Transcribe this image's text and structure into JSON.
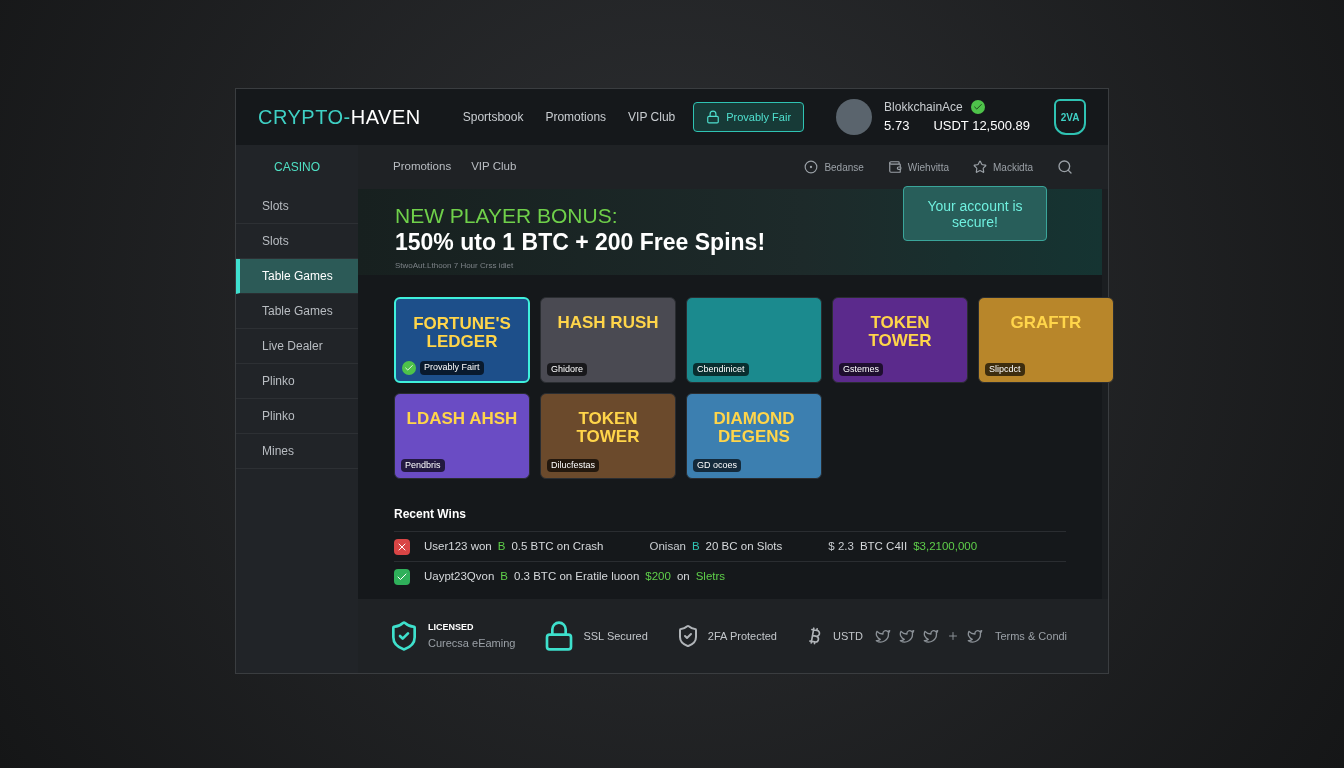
{
  "header": {
    "logo": {
      "part1": "CRYPTO-",
      "part2": "HAVEN"
    },
    "nav": [
      "Sportsbook",
      "Promotions",
      "VIP Club"
    ],
    "fair_button": "Provably Fair",
    "user": {
      "name": "BlokkchainAce",
      "verified": true,
      "stat": "5.73",
      "balance": "USDT 12,500.89"
    },
    "badge": "2VA"
  },
  "subnav": {
    "links": [
      "Promotions",
      "VIP Club"
    ],
    "tools": [
      {
        "kind": "coin",
        "label": "Bedanse"
      },
      {
        "kind": "wallet",
        "label": "Wiehvitta"
      },
      {
        "kind": "star",
        "label": "Mackidta"
      }
    ]
  },
  "sidebar": {
    "heading": "CASINO",
    "items": [
      {
        "label": "Slots",
        "selected": false
      },
      {
        "label": "Slots",
        "selected": false
      },
      {
        "label": "Table Games",
        "selected": true
      },
      {
        "label": "Table Games",
        "selected": false
      },
      {
        "label": "Live Dealer",
        "selected": false
      },
      {
        "label": "Plinko",
        "selected": false
      },
      {
        "label": "Plinko",
        "selected": false
      },
      {
        "label": "Mines",
        "selected": false
      }
    ]
  },
  "banner": {
    "kicker": "NEW PLAYER BONUS:",
    "headline": "150% uto 1 BTC + 200 Free Spins!",
    "fine_print": "StwoAut.Lthoon 7 Hour Crss idiet",
    "secure_note": "Your account is secure!"
  },
  "games": [
    {
      "title": "FORTUNE'S LEDGER",
      "caption": "Provably Fairt",
      "selected": true,
      "verified": true,
      "color": "#1d4f8a"
    },
    {
      "title": "HASH RUSH",
      "caption": "Ghidore",
      "selected": false,
      "verified": false,
      "color": "#4a4a52"
    },
    {
      "caption": "Cbendinicet",
      "selected": false,
      "verified": false,
      "color": "#1b8a8e"
    },
    {
      "title": "TOKEN TOWER",
      "caption": "Gstemes",
      "selected": false,
      "verified": false,
      "color": "#5b2a8c"
    },
    {
      "title": "GRAFTR",
      "caption": "Slipcdct",
      "selected": false,
      "verified": false,
      "color": "#b8862a"
    },
    {
      "title": "LDASH AHSH",
      "caption": "Pendbris",
      "selected": false,
      "verified": false,
      "color": "#6a4cc4"
    },
    {
      "title": "TOKEN TOWER",
      "caption": "Dilucfestas",
      "selected": false,
      "verified": false,
      "color": "#6b4a2c"
    },
    {
      "title": "DIAMOND DEGENS",
      "caption": "GD ocoes",
      "selected": false,
      "verified": false,
      "color": "#3c7fb0"
    }
  ],
  "recent_wins": {
    "title": "Recent Wins",
    "rows": [
      {
        "kind": "loss",
        "segments": [
          {
            "kind": "plain",
            "text": "User123 won"
          },
          {
            "kind": "green",
            "text": "B"
          },
          {
            "kind": "plain",
            "text": "0.5 BTC on Crash"
          },
          {
            "kind": "gap",
            "text": "Onisan"
          },
          {
            "kind": "teal",
            "text": "B"
          },
          {
            "kind": "plain",
            "text": "20 BC on Slots"
          },
          {
            "kind": "gap",
            "text": "$ 2.3"
          },
          {
            "kind": "plain",
            "text": "BTC  C4II"
          },
          {
            "kind": "green",
            "text": "$3,2100,000"
          }
        ]
      },
      {
        "kind": "win",
        "segments": [
          {
            "kind": "plain",
            "text": "Uaypt23Qvon"
          },
          {
            "kind": "green",
            "text": "B"
          },
          {
            "kind": "plain",
            "text": "0.3 BTC on Eratile luoon"
          },
          {
            "kind": "green",
            "text": "$200"
          },
          {
            "kind": "plain",
            "text": "on"
          },
          {
            "kind": "green",
            "text": "Sletrs"
          }
        ]
      }
    ]
  },
  "footer": {
    "license": {
      "title": "LICENSED",
      "subtitle": "Curecsa eEaming"
    },
    "items": [
      {
        "kind": "lock",
        "label": "SSL Secured"
      },
      {
        "kind": "shield",
        "label": "2FA Protected"
      },
      {
        "kind": "coin",
        "label": "USTD"
      }
    ],
    "terms": "Terms & Condi"
  }
}
